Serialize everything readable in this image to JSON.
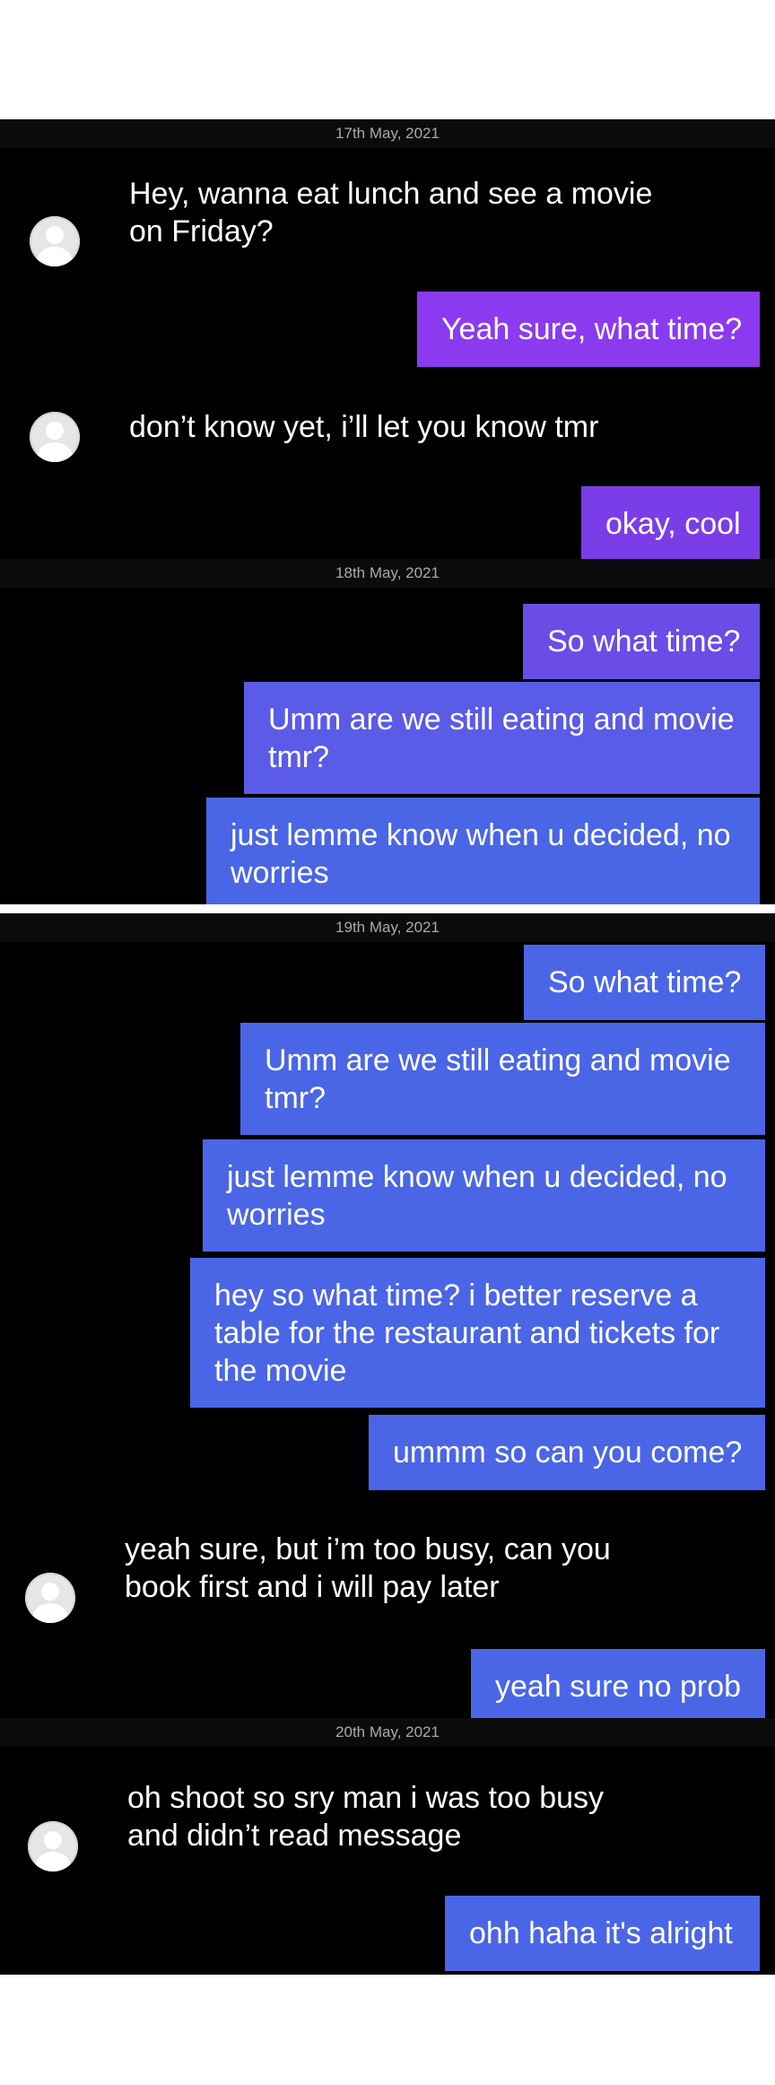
{
  "panels": [
    {
      "date": "17th May, 2021",
      "messages": [
        {
          "dir": "in",
          "lines": [
            "Hey, wanna eat lunch and see a movie",
            "on Friday?"
          ],
          "avatar": "avatar-icon"
        },
        {
          "dir": "out",
          "lines": [
            "Yeah sure, what time?"
          ]
        },
        {
          "dir": "in",
          "lines": [
            "don’t know yet, i’ll let you know tmr"
          ],
          "avatar": "avatar-icon"
        },
        {
          "dir": "out",
          "lines": [
            "okay, cool"
          ]
        }
      ]
    },
    {
      "date": "18th May, 2021",
      "messages": [
        {
          "dir": "out",
          "lines": [
            "So what time?"
          ]
        },
        {
          "dir": "out",
          "lines": [
            "Umm are we still eating and movie",
            "tmr?"
          ]
        },
        {
          "dir": "out",
          "lines": [
            "just lemme know when u decided, no",
            "worries"
          ]
        }
      ]
    },
    {
      "date": "19th May, 2021",
      "messages": [
        {
          "dir": "out",
          "lines": [
            "So what time?"
          ]
        },
        {
          "dir": "out",
          "lines": [
            "Umm are we still eating and movie",
            "tmr?"
          ]
        },
        {
          "dir": "out",
          "lines": [
            "just lemme know when u decided, no",
            "worries"
          ]
        },
        {
          "dir": "out",
          "lines": [
            "hey so what time? i better reserve a",
            "table for the restaurant and tickets for",
            "the movie"
          ]
        },
        {
          "dir": "out",
          "lines": [
            "ummm so can you come?"
          ]
        },
        {
          "dir": "in",
          "lines": [
            "yeah sure, but i’m too busy, can you",
            "book first and i will pay later"
          ],
          "avatar": "avatar-icon"
        },
        {
          "dir": "out",
          "lines": [
            "yeah sure no prob"
          ]
        }
      ]
    },
    {
      "date": "20th May, 2021",
      "messages": [
        {
          "dir": "in",
          "lines": [
            "oh shoot so sry man i was too busy",
            "and didn’t read message"
          ],
          "avatar": "avatar-icon"
        },
        {
          "dir": "out",
          "lines": [
            "ohh haha it's alright"
          ]
        }
      ]
    }
  ],
  "colors": {
    "incoming_bubble": "#262626",
    "outgoing_gradient": [
      "#8b3af0",
      "#7b3de8",
      "#6a4de6",
      "#5a5be6",
      "#4a66e6"
    ],
    "background": "#000000",
    "date_text": "#a9a9a9"
  }
}
